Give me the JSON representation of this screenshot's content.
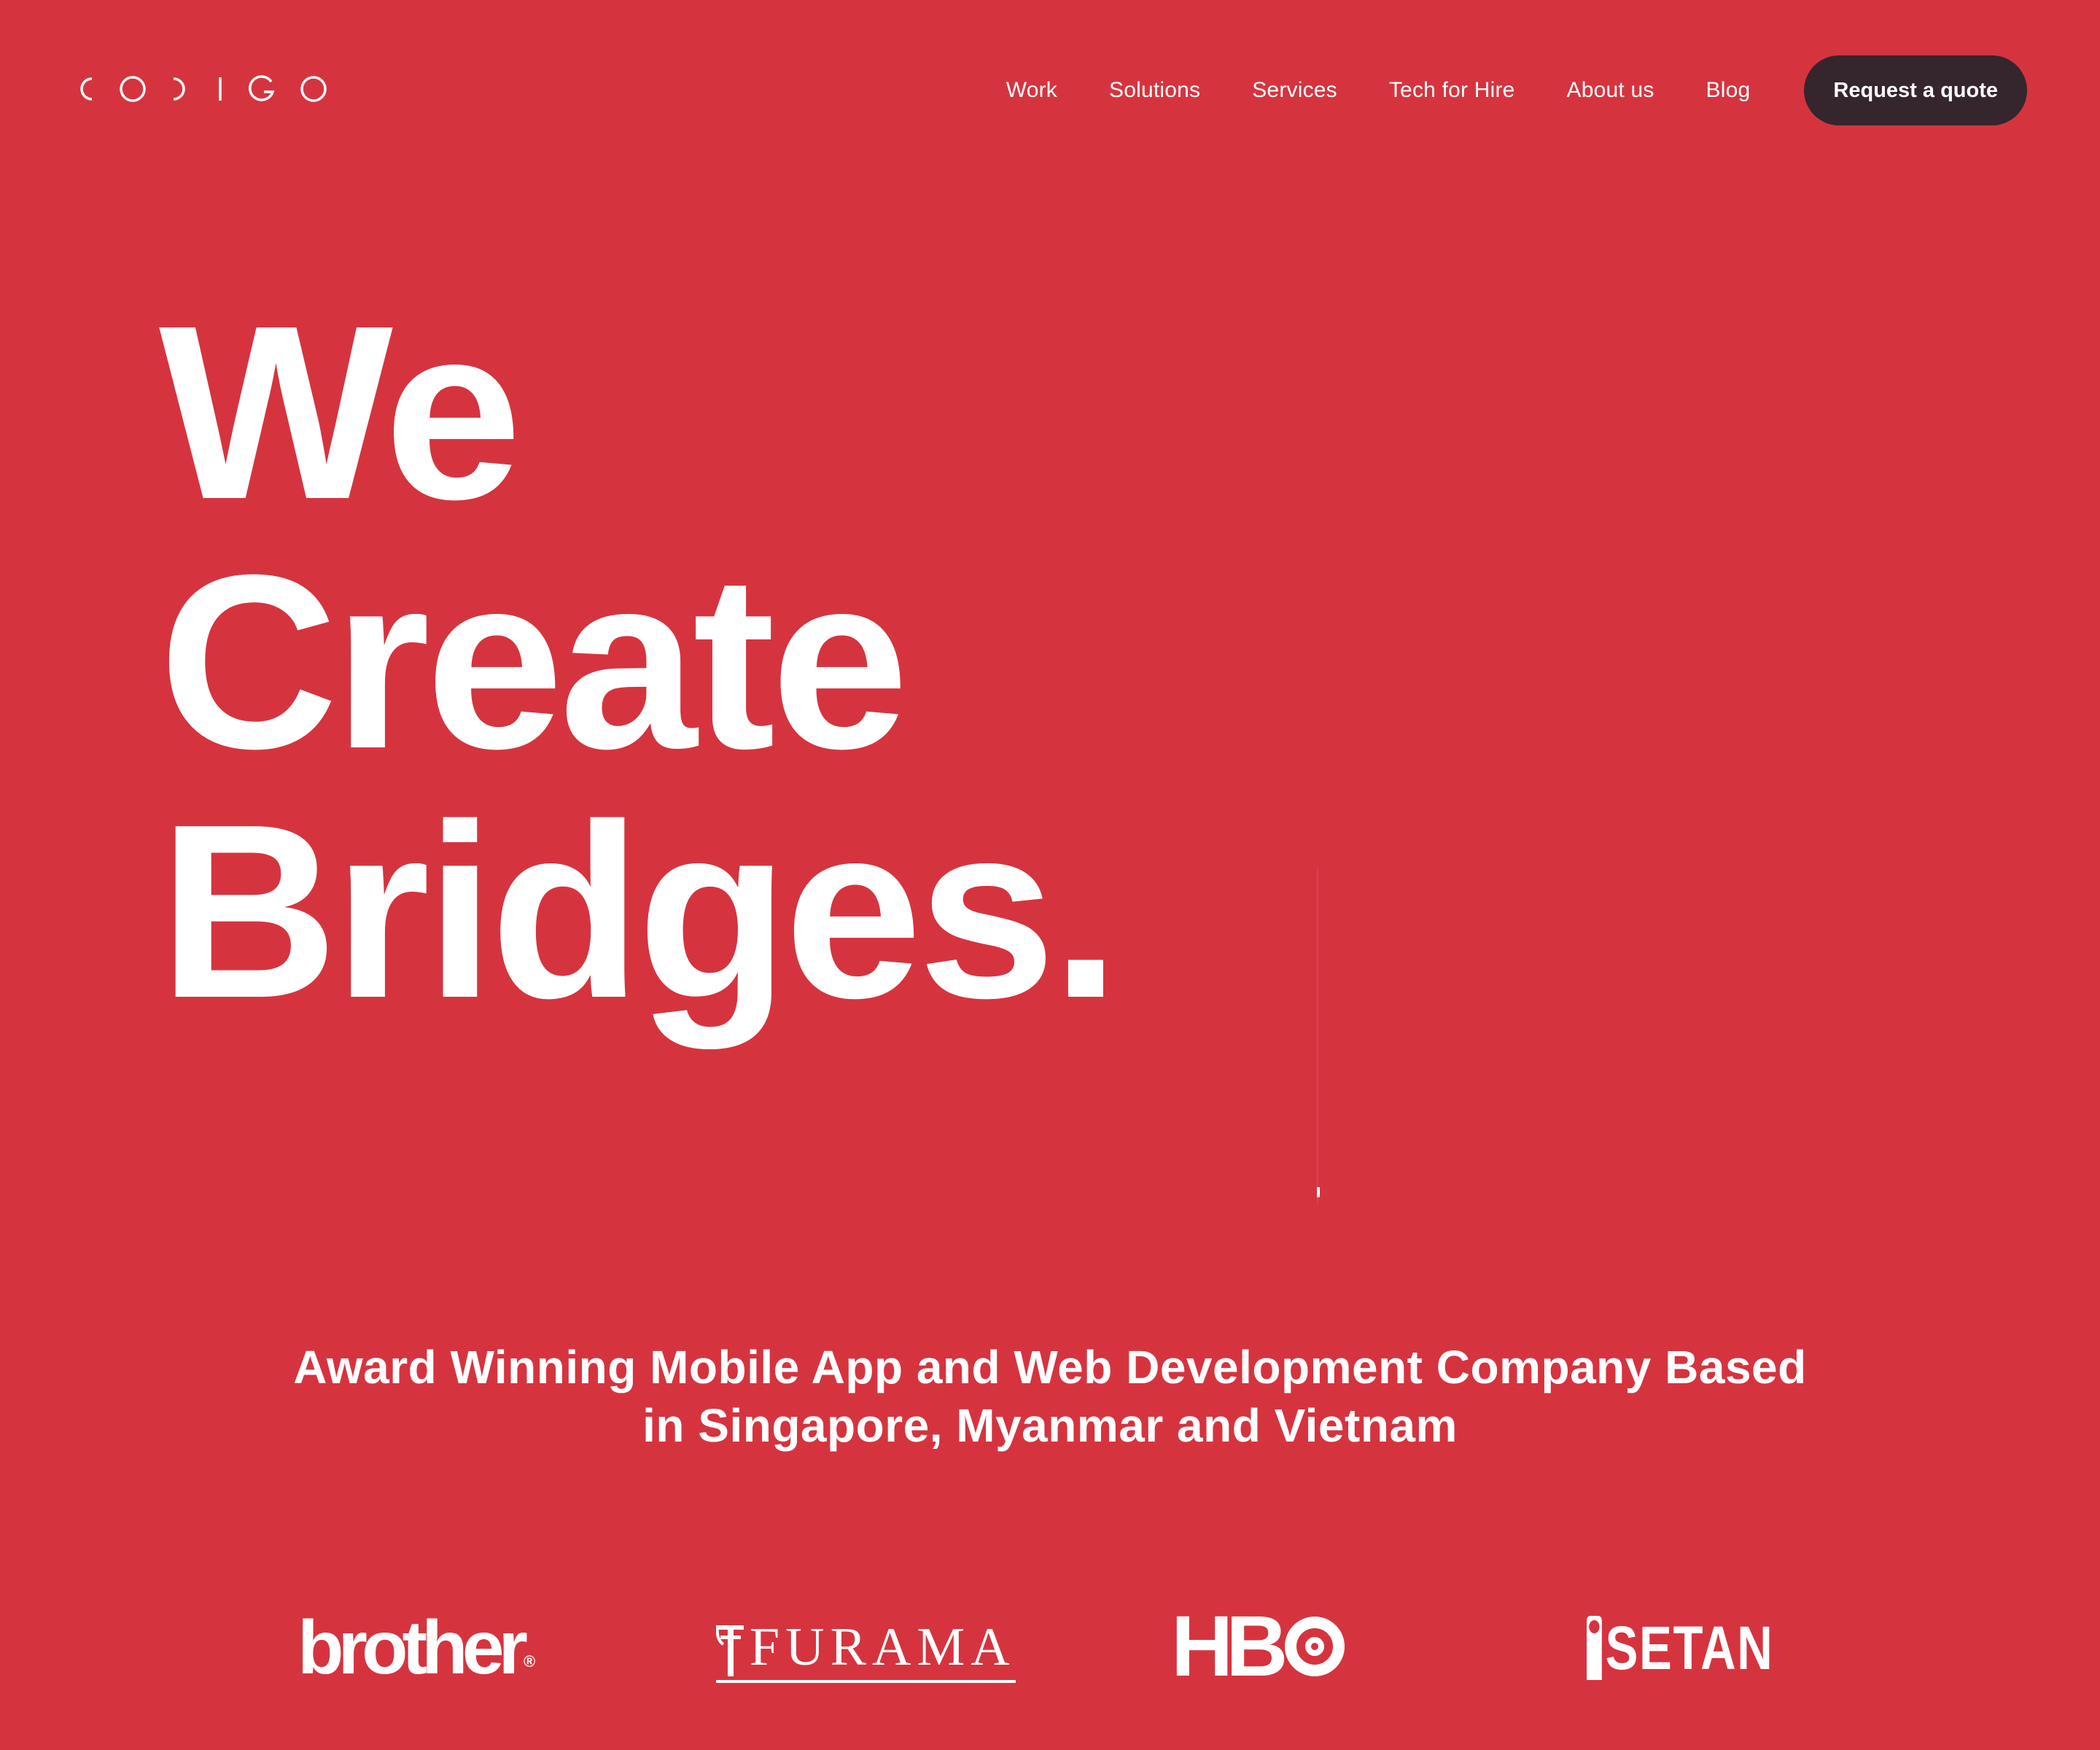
{
  "brand": {
    "logo_text": "CODIGO",
    "background_color": "#D5343F",
    "button_color": "#35252D",
    "text_color": "#FFFFFF"
  },
  "nav": {
    "items": [
      {
        "label": "Work"
      },
      {
        "label": "Solutions"
      },
      {
        "label": "Services"
      },
      {
        "label": "Tech for Hire"
      },
      {
        "label": "About us"
      },
      {
        "label": "Blog"
      }
    ],
    "cta_label": "Request a quote"
  },
  "hero": {
    "lines": [
      "We",
      "Create",
      "Bridges."
    ]
  },
  "tagline": {
    "line1": "Award Winning Mobile App and Web Development Company Based",
    "line2": "in Singapore, Myanmar and Vietnam"
  },
  "clients": [
    {
      "name": "brother",
      "mark": "®"
    },
    {
      "name": "FURAMA"
    },
    {
      "name": "HBO",
      "text": "HB"
    },
    {
      "name": "ISETAN",
      "text": "SETAN"
    }
  ]
}
